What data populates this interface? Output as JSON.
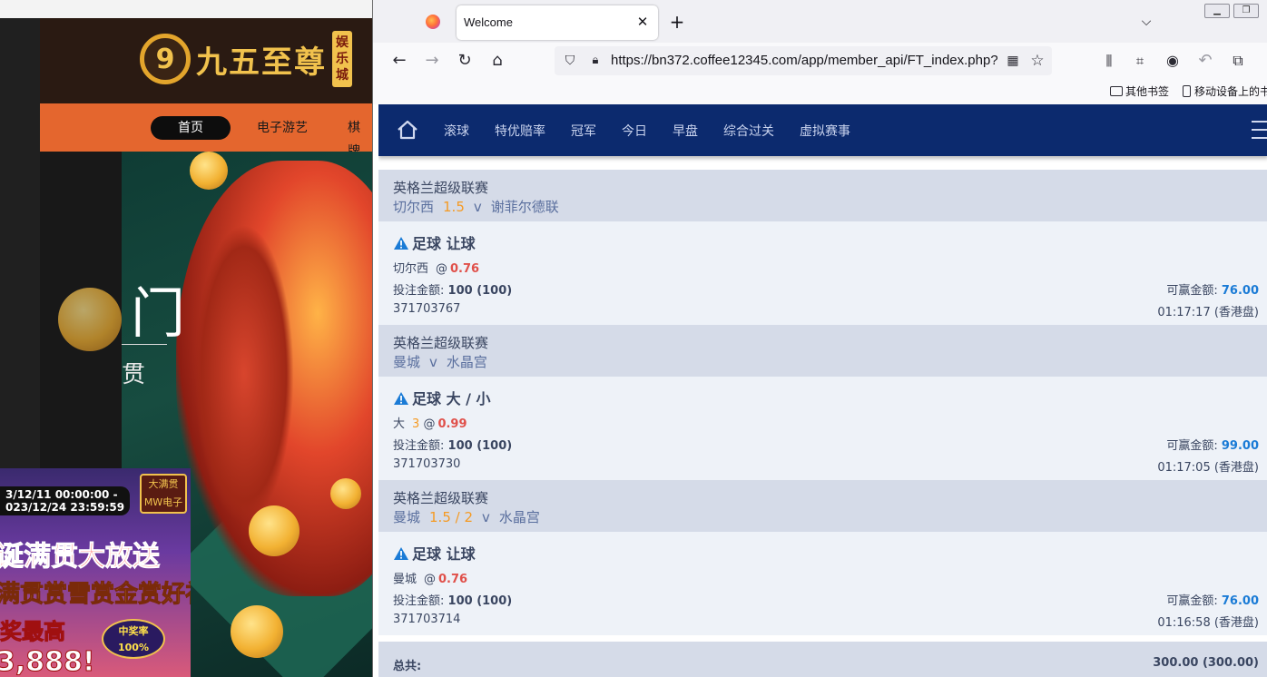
{
  "background_site": {
    "logo_text": "九五至尊",
    "logo_side": "娱乐城",
    "nav": [
      "首页",
      "电子游艺",
      "棋牌"
    ],
    "hero_glyph": "门",
    "hero_small": "贯",
    "promo": {
      "date": "3/12/11 00:00:00 -\n023/12/24 23:59:59",
      "badge": "大满贯\nMW电子",
      "title": "诞满贯大放送",
      "subtitle": "满贯赏雪赏金赏好礼",
      "max": "奖最高",
      "amount": "3,888!",
      "rate": "中奖率\n100%"
    }
  },
  "browser": {
    "tab_title": "Welcome",
    "url": "https://bn372.coffee12345.com/app/member_api/FT_index.php?",
    "bookmarks": [
      "其他书签",
      "移动设备上的书"
    ]
  },
  "site_nav": [
    "滚球",
    "特优赔率",
    "冠军",
    "今日",
    "早盘",
    "综合过关",
    "虚拟赛事"
  ],
  "labels": {
    "stake": "投注金额:",
    "win": "可赢金额:",
    "at": "@",
    "vs": "v",
    "total": "总共:"
  },
  "bets": [
    {
      "league": "英格兰超级联赛",
      "home": "切尔西",
      "handicap": "1.5",
      "away": "谢菲尔德联",
      "type": "足球 让球",
      "selection": "切尔西",
      "line": "",
      "odds": "0.76",
      "stake": "100 (100)",
      "win": "76.00",
      "ticket": "371703767",
      "time": "01:17:17 (香港盘)"
    },
    {
      "league": "英格兰超级联赛",
      "home": "曼城",
      "handicap": "",
      "away": "水晶宫",
      "type": "足球 大 / 小",
      "selection": "大",
      "line": "3",
      "odds": "0.99",
      "stake": "100 (100)",
      "win": "99.00",
      "ticket": "371703730",
      "time": "01:17:05 (香港盘)"
    },
    {
      "league": "英格兰超级联赛",
      "home": "曼城",
      "handicap": "1.5 / 2",
      "away": "水晶宫",
      "type": "足球 让球",
      "selection": "曼城",
      "line": "",
      "odds": "0.76",
      "stake": "100 (100)",
      "win": "76.00",
      "ticket": "371703714",
      "time": "01:16:58 (香港盘)"
    }
  ],
  "total": "300.00 (300.00)",
  "colors": {
    "site_nav_bg": "#0c2a6e",
    "league_bg": "#d5dbe8",
    "detail_bg": "#eef2f8",
    "handicap": "#f59a23",
    "odds": "#e0504a",
    "win_amount": "#1a7bd6",
    "warning": "#1a7bd6"
  },
  "icons": [
    "firefox-icon",
    "close-icon",
    "plus-icon",
    "chevron-down-icon",
    "back-icon",
    "forward-icon",
    "reload-icon",
    "home-icon",
    "shield-icon",
    "lock-icon",
    "qr-code-icon",
    "star-icon",
    "library-icon",
    "crop-icon",
    "chat-icon",
    "undo-icon",
    "extensions-icon",
    "warning-icon",
    "hamburger-menu-icon"
  ]
}
